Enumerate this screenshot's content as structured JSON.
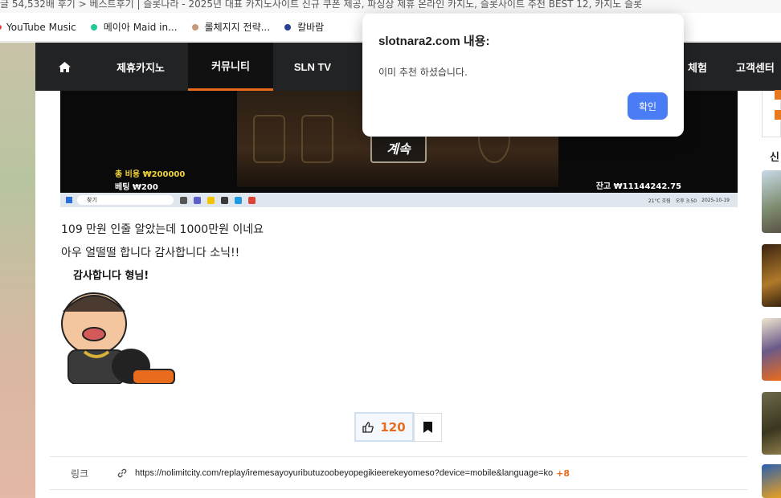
{
  "browser": {
    "tab_title_fragment": "글 54,532배 후기 > 베스트후기 | 슬롯나라 - 2025년 대표 카지노사이트 신규 쿠폰 제공, 파싱상 제휴 온라인 카지노, 슬롯사이트 추천 BEST 12, 카지노 슬롯",
    "bookmarks": [
      {
        "label": "YouTube Music",
        "color": "#e53935"
      },
      {
        "label": "메이아 Maid in...",
        "color": "#20c997"
      },
      {
        "label": "롤체지지 전략...",
        "color": "#c49a7a"
      },
      {
        "label": "칼바람",
        "color": "#2c3e8f"
      }
    ]
  },
  "nav": {
    "home_icon": "home-icon",
    "items": [
      "제휴카지노",
      "커뮤니티",
      "SLN TV"
    ],
    "active": "커뮤니티",
    "right_items": [
      "체험",
      "고객센터"
    ],
    "accent": "#e86b1e"
  },
  "game": {
    "continue_label": "계속",
    "total_cost": "총 비용 ₩200000",
    "bet": "베팅 ₩200",
    "balance": "잔고 ₩11144242.75",
    "taskbar_search": "찾기",
    "taskbar_weather": "21°C 흐림",
    "taskbar_time": "오후 3:50",
    "taskbar_date": "2025-10-19"
  },
  "post": {
    "line1": "109 만원 인줄 알았는데 1000만원 이네요",
    "line2": "아우 얼떨떨 합니다 감사합니다 소닉!!",
    "sticker_caption": "감사합니다 형님!"
  },
  "actions": {
    "like_icon": "thumbs-up-icon",
    "like_count": "120",
    "bookmark_icon": "bookmark-icon"
  },
  "link": {
    "label": "링크",
    "icon": "link-icon",
    "url": "https://nolimitcity.com/replay/iremesayoyuributuzoobeyopegikieerekeyomeso?device=mobile&language=ko",
    "count": "+8"
  },
  "sidebar": {
    "title_fragment": "신"
  },
  "dialog": {
    "title": "slotnara2.com 내용:",
    "message": "이미 추천 하셨습니다.",
    "ok_label": "확인",
    "ok_color": "#4a7cf6"
  }
}
